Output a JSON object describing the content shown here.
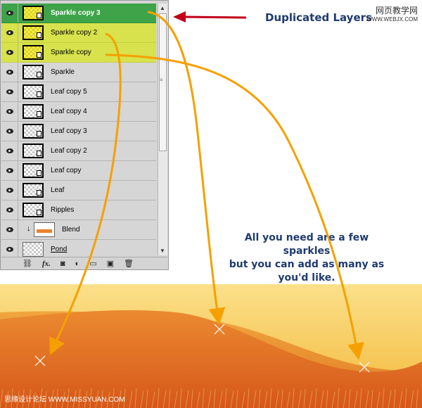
{
  "layers_panel": {
    "layers": [
      {
        "name": "Sparkle copy 3",
        "state": "active",
        "thumb": "yellow-linked"
      },
      {
        "name": "Sparkle copy 2",
        "state": "selected",
        "thumb": "yellow-linked"
      },
      {
        "name": "Sparkle copy",
        "state": "selected",
        "thumb": "yellow-linked"
      },
      {
        "name": "Sparkle",
        "state": "normal",
        "thumb": "transparent-linked"
      },
      {
        "name": "Leaf copy 5",
        "state": "normal",
        "thumb": "transparent-linked"
      },
      {
        "name": "Leaf copy 4",
        "state": "normal",
        "thumb": "transparent-linked"
      },
      {
        "name": "Leaf copy 3",
        "state": "normal",
        "thumb": "transparent-linked"
      },
      {
        "name": "Leaf copy 2",
        "state": "normal",
        "thumb": "transparent-linked"
      },
      {
        "name": "Leaf copy",
        "state": "normal",
        "thumb": "transparent-linked"
      },
      {
        "name": "Leaf",
        "state": "normal",
        "thumb": "transparent-linked"
      },
      {
        "name": "Ripples",
        "state": "normal",
        "thumb": "transparent-linked"
      },
      {
        "name": "Blend",
        "state": "clipped",
        "thumb": "blend"
      },
      {
        "name": "Pond",
        "state": "normal",
        "thumb": "transparent"
      }
    ],
    "toolbar_icons": [
      "link-layers-icon",
      "fx-icon",
      "layer-mask-icon",
      "adjustment-layer-icon",
      "new-group-icon",
      "new-layer-icon",
      "delete-layer-icon"
    ],
    "fx_label": "fx."
  },
  "callouts": {
    "duplicated": "Duplicated Layers",
    "sparkles_line1": "All you need are a few sparkles",
    "sparkles_line2": "but you can add as many as",
    "sparkles_line3": "you'd like."
  },
  "watermarks": {
    "top_cn": "网页教学网",
    "top_url": "WWW.WEBJX.COM",
    "bottom": "思缘设计论坛 WWW.MISSYUAN.COM"
  },
  "colors": {
    "active_layer": "#3fa34a",
    "selected_layer": "#d7e24c",
    "callout_text": "#1f3b6e",
    "arrow_orange": "#f5a000",
    "arrow_red": "#c0001a",
    "sand_light": "#f6c84a",
    "sand_dark": "#e2701e"
  }
}
